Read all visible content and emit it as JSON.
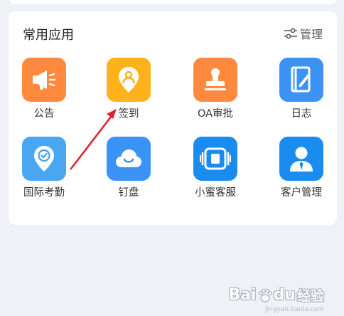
{
  "section": {
    "title": "常用应用",
    "manage_label": "管理"
  },
  "apps": [
    {
      "label": "公告",
      "icon": "megaphone-icon",
      "color": "#ff8a3d"
    },
    {
      "label": "签到",
      "icon": "location-pin-person-icon",
      "color": "#ffb21a"
    },
    {
      "label": "OA审批",
      "icon": "stamp-icon",
      "color": "#ff8a3d"
    },
    {
      "label": "日志",
      "icon": "notebook-pen-icon",
      "color": "#3b93f5"
    },
    {
      "label": "国际考勤",
      "icon": "location-check-icon",
      "color": "#4aa6f0"
    },
    {
      "label": "钉盘",
      "icon": "cloud-smile-icon",
      "color": "#3b93f5"
    },
    {
      "label": "小蜜客服",
      "icon": "robot-screen-icon",
      "color": "#1a8cf0"
    },
    {
      "label": "客户管理",
      "icon": "customer-person-icon",
      "color": "#1a8cf0"
    }
  ],
  "annotation": {
    "color": "#e0232e"
  },
  "watermark": {
    "brand": "Bai",
    "brand_suffix": "du",
    "product": "经验",
    "domain": "jingyan.baidu.com"
  }
}
